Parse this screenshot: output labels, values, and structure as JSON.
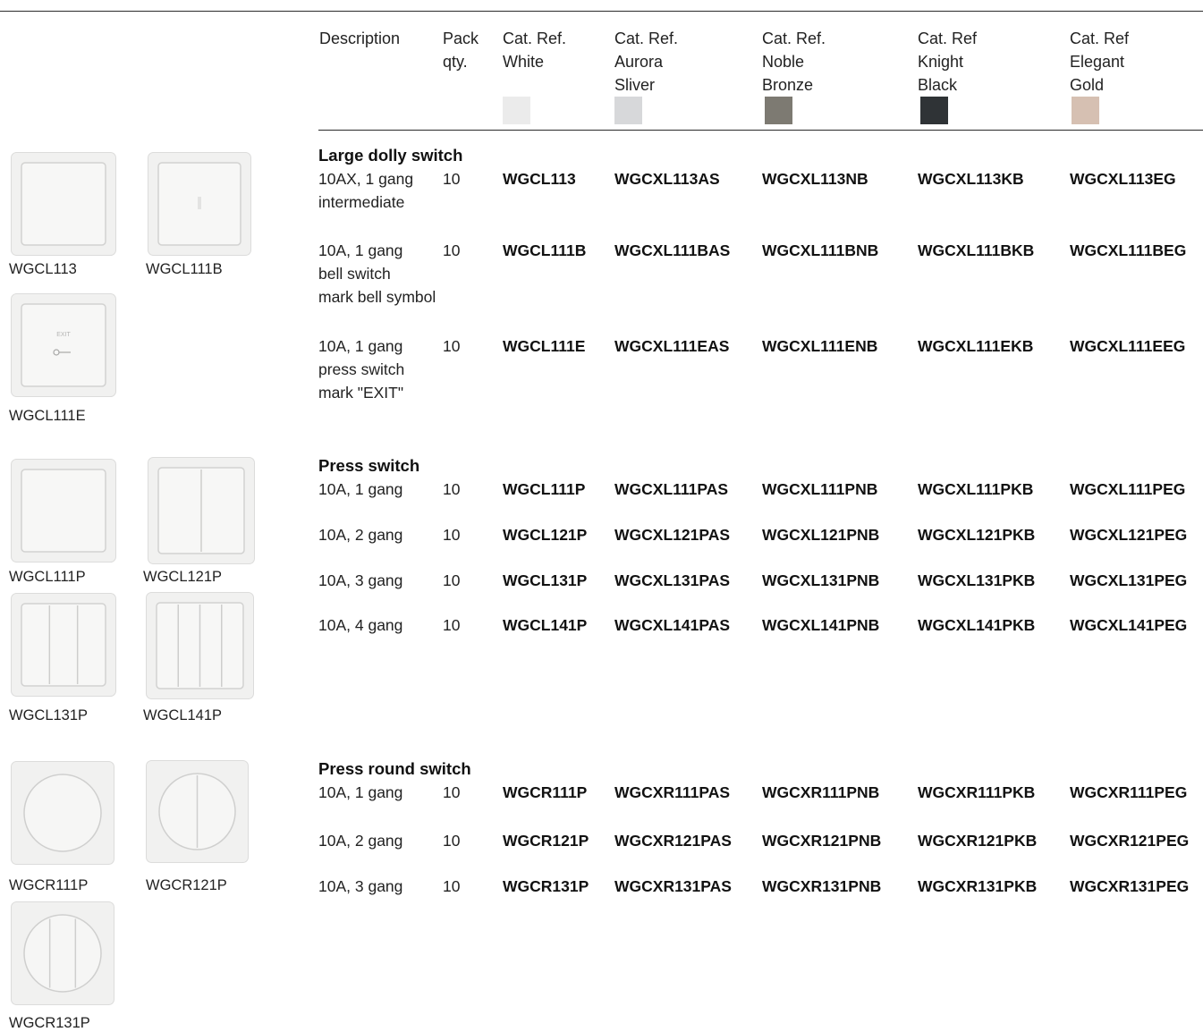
{
  "headers": {
    "description": "Description",
    "pack": "Pack\nqty.",
    "white": "Cat. Ref.\nWhite",
    "aurora": "Cat. Ref.\nAurora\nSliver",
    "noble": "Cat. Ref.\nNoble\n Bronze",
    "knight": "Cat. Ref\nKnight\n Black",
    "elegant": "Cat. Ref\nElegant\n Gold"
  },
  "colors": {
    "white": "#ebebeb",
    "aurora": "#d7d8da",
    "noble": "#7d7a72",
    "knight": "#2f3336",
    "elegant": "#d6c0b2"
  },
  "sections": [
    {
      "title": "Large dolly switch",
      "rows": [
        {
          "desc": "10AX, 1 gang\nintermediate",
          "pack": "10",
          "white": "WGCL113",
          "aurora": "WGCXL113AS",
          "noble": "WGCXL113NB",
          "knight": "WGCXL113KB",
          "elegant": "WGCXL113EG"
        },
        {
          "desc": "10A, 1 gang\nbell switch\nmark bell symbol",
          "pack": "10",
          "white": "WGCL111B",
          "aurora": "WGCXL111BAS",
          "noble": "WGCXL111BNB",
          "knight": "WGCXL111BKB",
          "elegant": "WGCXL111BEG"
        },
        {
          "desc": "10A, 1 gang\npress switch\nmark \"EXIT\"",
          "pack": "10",
          "white": "WGCL111E",
          "aurora": "WGCXL111EAS",
          "noble": "WGCXL111ENB",
          "knight": "WGCXL111EKB",
          "elegant": "WGCXL111EEG"
        }
      ]
    },
    {
      "title": "Press switch",
      "rows": [
        {
          "desc": "10A, 1 gang",
          "pack": "10",
          "white": "WGCL111P",
          "aurora": "WGCXL111PAS",
          "noble": "WGCXL111PNB",
          "knight": "WGCXL111PKB",
          "elegant": "WGCXL111PEG"
        },
        {
          "desc": "10A, 2 gang",
          "pack": "10",
          "white": "WGCL121P",
          "aurora": "WGCXL121PAS",
          "noble": "WGCXL121PNB",
          "knight": "WGCXL121PKB",
          "elegant": "WGCXL121PEG"
        },
        {
          "desc": "10A, 3 gang",
          "pack": "10",
          "white": "WGCL131P",
          "aurora": "WGCXL131PAS",
          "noble": "WGCXL131PNB",
          "knight": "WGCXL131PKB",
          "elegant": "WGCXL131PEG"
        },
        {
          "desc": "10A, 4 gang",
          "pack": "10",
          "white": "WGCL141P",
          "aurora": "WGCXL141PAS",
          "noble": "WGCXL141PNB",
          "knight": "WGCXL141PKB",
          "elegant": "WGCXL141PEG"
        }
      ]
    },
    {
      "title": "Press round switch",
      "rows": [
        {
          "desc": "10A, 1 gang",
          "pack": "10",
          "white": "WGCR111P",
          "aurora": "WGCXR111PAS",
          "noble": "WGCXR111PNB",
          "knight": "WGCXR111PKB",
          "elegant": "WGCXR111PEG"
        },
        {
          "desc": "10A, 2 gang",
          "pack": "10",
          "white": "WGCR121P",
          "aurora": "WGCXR121PAS",
          "noble": "WGCXR121PNB",
          "knight": "WGCXR121PKB",
          "elegant": "WGCXR121PEG"
        },
        {
          "desc": "10A, 3 gang",
          "pack": "10",
          "white": "WGCR131P",
          "aurora": "WGCXR131PAS",
          "noble": "WGCXR131PNB",
          "knight": "WGCXR131PKB",
          "elegant": "WGCXR131PEG"
        }
      ]
    }
  ],
  "products": [
    {
      "label": "WGCL113",
      "kind": "dolly"
    },
    {
      "label": "WGCL111B",
      "kind": "bell"
    },
    {
      "label": "WGCL111E",
      "kind": "exit",
      "plate_text": "EXIT"
    },
    {
      "label": "WGCL111P",
      "kind": "press-1"
    },
    {
      "label": "WGCL121P",
      "kind": "press-2"
    },
    {
      "label": "WGCL131P",
      "kind": "press-3"
    },
    {
      "label": "WGCL141P",
      "kind": "press-4"
    },
    {
      "label": "WGCR111P",
      "kind": "round-1"
    },
    {
      "label": "WGCR121P",
      "kind": "round-2"
    },
    {
      "label": "WGCR131P",
      "kind": "round-3"
    }
  ]
}
